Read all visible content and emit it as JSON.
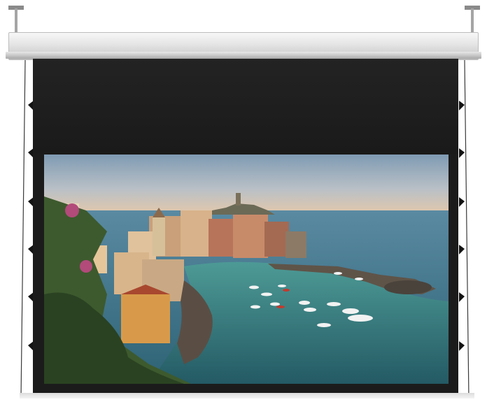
{
  "scene": {
    "subject": "projector-screen",
    "colors": {
      "frame": "#1b1b1b",
      "housing": "#e4e4e4",
      "sky_top": "#7f9bb3",
      "sky_horizon": "#e9c9a8",
      "sea": "#2f6878",
      "harbor_water": "#3e8a8c"
    }
  }
}
